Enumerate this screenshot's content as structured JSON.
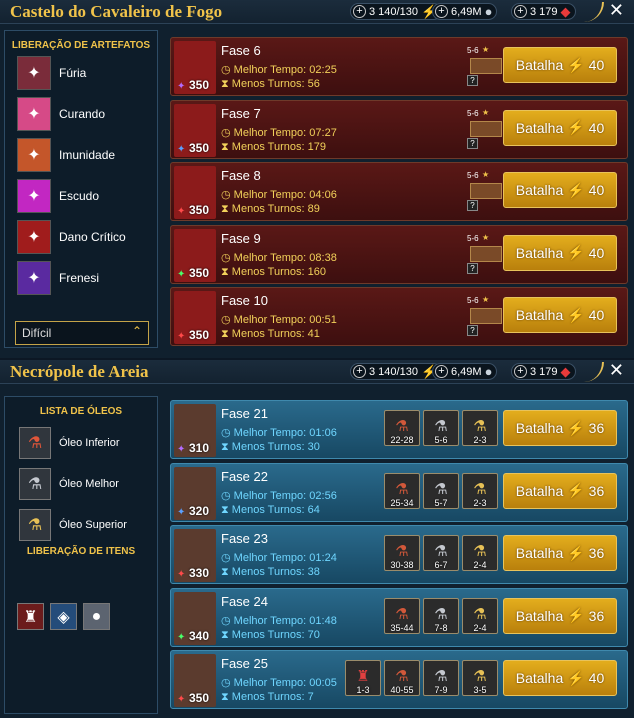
{
  "panel1": {
    "title": "Castelo do Cavaleiro de Fogo",
    "currencies": {
      "energy": "3 140/130",
      "silver": "6,49M",
      "gems": "3 179"
    },
    "sidebar": {
      "heading": "LIBERAÇÃO DE ARTEFATOS",
      "items": [
        {
          "label": "Fúria",
          "color": "#7a2c3a"
        },
        {
          "label": "Curando",
          "color": "#d64a87"
        },
        {
          "label": "Imunidade",
          "color": "#c4562a"
        },
        {
          "label": "Escudo",
          "color": "#c227c2"
        },
        {
          "label": "Dano Crítico",
          "color": "#a01c1c"
        },
        {
          "label": "Frenesi",
          "color": "#5a2aa0"
        }
      ],
      "difficulty": "Difícil"
    },
    "rows": [
      {
        "stage": "Fase 6",
        "best": "Melhor Tempo: 02:25",
        "turns": "Menos Turnos: 56",
        "power": "350",
        "lvl": "5-6",
        "btn": "Batalha",
        "cost": "40"
      },
      {
        "stage": "Fase 7",
        "best": "Melhor Tempo: 07:27",
        "turns": "Menos Turnos: 179",
        "power": "350",
        "lvl": "5-6",
        "btn": "Batalha",
        "cost": "40"
      },
      {
        "stage": "Fase 8",
        "best": "Melhor Tempo: 04:06",
        "turns": "Menos Turnos: 89",
        "power": "350",
        "lvl": "5-6",
        "btn": "Batalha",
        "cost": "40"
      },
      {
        "stage": "Fase 9",
        "best": "Melhor Tempo: 08:38",
        "turns": "Menos Turnos: 160",
        "power": "350",
        "lvl": "5-6",
        "btn": "Batalha",
        "cost": "40"
      },
      {
        "stage": "Fase 10",
        "best": "Melhor Tempo: 00:51",
        "turns": "Menos Turnos: 41",
        "power": "350",
        "lvl": "5-6",
        "btn": "Batalha",
        "cost": "40"
      }
    ]
  },
  "panel2": {
    "title": "Necrópole de Areia",
    "currencies": {
      "energy": "3 140/130",
      "silver": "6,49M",
      "gems": "3 179"
    },
    "sidebar": {
      "heading": "LISTA DE ÓLEOS",
      "oils": [
        {
          "label": "Óleo Inferior"
        },
        {
          "label": "Óleo Melhor"
        },
        {
          "label": "Óleo Superior"
        }
      ],
      "heading2": "LIBERAÇÃO DE ITENS"
    },
    "rows": [
      {
        "stage": "Fase 21",
        "best": "Melhor Tempo: 01:06",
        "turns": "Menos Turnos: 30",
        "power": "310",
        "loot": [
          "22-28",
          "5-6",
          "2-3"
        ],
        "btn": "Batalha",
        "cost": "36"
      },
      {
        "stage": "Fase 22",
        "best": "Melhor Tempo: 02:56",
        "turns": "Menos Turnos: 64",
        "power": "320",
        "loot": [
          "25-34",
          "5-7",
          "2-3"
        ],
        "btn": "Batalha",
        "cost": "36"
      },
      {
        "stage": "Fase 23",
        "best": "Melhor Tempo: 01:24",
        "turns": "Menos Turnos: 38",
        "power": "330",
        "loot": [
          "30-38",
          "6-7",
          "2-4"
        ],
        "btn": "Batalha",
        "cost": "36"
      },
      {
        "stage": "Fase 24",
        "best": "Melhor Tempo: 01:48",
        "turns": "Menos Turnos: 70",
        "power": "340",
        "loot": [
          "35-44",
          "7-8",
          "2-4"
        ],
        "btn": "Batalha",
        "cost": "36"
      },
      {
        "stage": "Fase 25",
        "best": "Melhor Tempo: 00:05",
        "turns": "Menos Turnos: 7",
        "power": "350",
        "loot": [
          "1-3",
          "40-55",
          "7-9",
          "3-5"
        ],
        "btn": "Batalha",
        "cost": "40"
      }
    ]
  }
}
